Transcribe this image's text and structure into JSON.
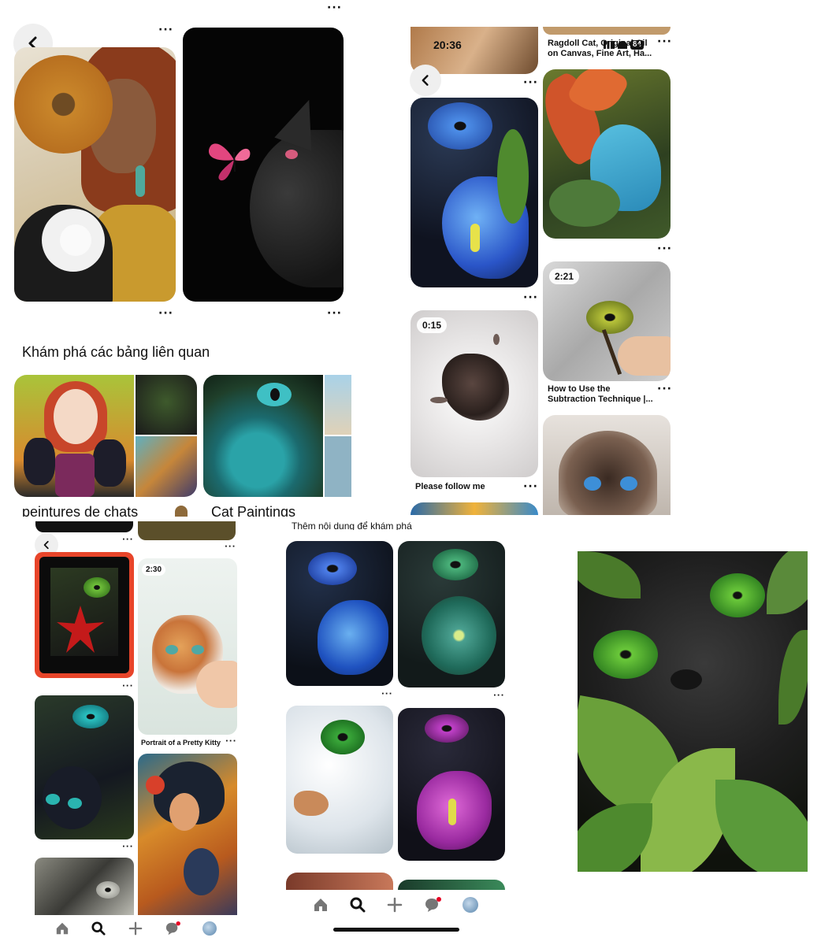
{
  "panel1": {
    "section_title": "Khám phá các bảng liên quan",
    "boards": [
      {
        "name": "peintures de chats"
      },
      {
        "name": "Cat Paintings"
      }
    ]
  },
  "panel2": {
    "status_time": "20:36",
    "battery": "84",
    "pins": [
      {
        "caption": "Ragdoll Cat, Original Oil on Canvas, Fine Art, Ha..."
      },
      {
        "caption": "How to Use the Subtraction Technique |...",
        "duration": "2:21"
      },
      {
        "caption": "Please follow me",
        "duration": "0:15"
      }
    ]
  },
  "panel3": {
    "pins": [
      {
        "caption": "Portrait of a Pretty Kitty",
        "duration": "2:30"
      }
    ]
  },
  "panel4": {
    "section_title": "Thêm nội dung để khám phá"
  },
  "nav": {
    "items": [
      "home-icon",
      "search-icon",
      "create-icon",
      "messages-icon",
      "profile-icon"
    ]
  }
}
